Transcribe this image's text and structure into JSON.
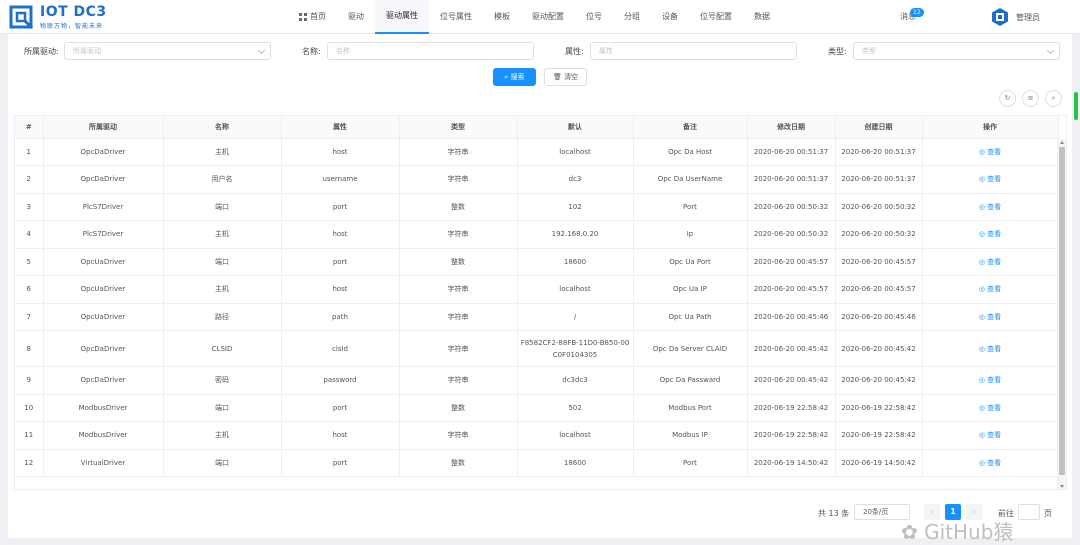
{
  "brand": {
    "title": "IOT DC3",
    "subtitle": "物联万物，智能未来",
    "accent": "#1890ff"
  },
  "nav": [
    {
      "label": "首页",
      "icon": "grid-icon"
    },
    {
      "label": "驱动"
    },
    {
      "label": "驱动属性",
      "active": true
    },
    {
      "label": "位号属性"
    },
    {
      "label": "模板"
    },
    {
      "label": "驱动配置"
    },
    {
      "label": "位号"
    },
    {
      "label": "分组"
    },
    {
      "label": "设备"
    },
    {
      "label": "位号配置"
    },
    {
      "label": "数据"
    }
  ],
  "header": {
    "messages_label": "消息",
    "messages_count": "12",
    "user_label": "管理员"
  },
  "filters": {
    "driver_label": "所属驱动:",
    "driver_placeholder": "所属驱动",
    "name_label": "名称:",
    "name_placeholder": "名称",
    "attr_label": "属性:",
    "attr_placeholder": "属性",
    "type_label": "类型:",
    "type_placeholder": "类型",
    "search_label": "搜索",
    "clear_label": "清空"
  },
  "table": {
    "columns": [
      "#",
      "所属驱动",
      "名称",
      "属性",
      "类型",
      "默认",
      "备注",
      "修改日期",
      "创建日期",
      "操作"
    ],
    "rows": [
      [
        "1",
        "OpcDaDriver",
        "主机",
        "host",
        "字符串",
        "localhost",
        "Opc Da Host",
        "2020-06-20 00:51:37",
        "2020-06-20 00:51:37",
        "查看"
      ],
      [
        "2",
        "OpcDaDriver",
        "用户名",
        "username",
        "字符串",
        "dc3",
        "Opc Da UserName",
        "2020-06-20 00:51:37",
        "2020-06-20 00:51:37",
        "查看"
      ],
      [
        "3",
        "PlcS7Driver",
        "端口",
        "port",
        "整数",
        "102",
        "Port",
        "2020-06-20 00:50:32",
        "2020-06-20 00:50:32",
        "查看"
      ],
      [
        "4",
        "PlcS7Driver",
        "主机",
        "host",
        "字符串",
        "192.168.0.20",
        "Ip",
        "2020-06-20 00:50:32",
        "2020-06-20 00:50:32",
        "查看"
      ],
      [
        "5",
        "OpcUaDriver",
        "端口",
        "port",
        "整数",
        "18600",
        "Opc Ua Port",
        "2020-06-20 00:45:57",
        "2020-06-20 00:45:57",
        "查看"
      ],
      [
        "6",
        "OpcUaDriver",
        "主机",
        "host",
        "字符串",
        "localhost",
        "Opc Ua IP",
        "2020-06-20 00:45:57",
        "2020-06-20 00:45:57",
        "查看"
      ],
      [
        "7",
        "OpcUaDriver",
        "路径",
        "path",
        "字符串",
        "/",
        "Opc Ua Path",
        "2020-06-20 00:45:46",
        "2020-06-20 00:45:46",
        "查看"
      ],
      [
        "8",
        "OpcDaDriver",
        "CLSID",
        "clsId",
        "字符串",
        "F8582CF2-88FB-11D0-B850-00C0F0104305",
        "Opc Da Server CLAID",
        "2020-06-20 00:45:42",
        "2020-06-20 00:45:42",
        "查看"
      ],
      [
        "9",
        "OpcDaDriver",
        "密码",
        "password",
        "字符串",
        "dc3dc3",
        "Opc Da Passward",
        "2020-06-20 00:45:42",
        "2020-06-20 00:45:42",
        "查看"
      ],
      [
        "10",
        "ModbusDriver",
        "端口",
        "port",
        "整数",
        "502",
        "Modbus Port",
        "2020-06-19 22:58:42",
        "2020-06-19 22:58:42",
        "查看"
      ],
      [
        "11",
        "ModbusDriver",
        "主机",
        "host",
        "字符串",
        "localhost",
        "Modbus IP",
        "2020-06-19 22:58:42",
        "2020-06-19 22:58:42",
        "查看"
      ],
      [
        "12",
        "VirtualDriver",
        "端口",
        "port",
        "整数",
        "18600",
        "Port",
        "2020-06-19 14:50:42",
        "2020-06-19 14:50:42",
        "查看"
      ]
    ]
  },
  "pagination": {
    "total": "共 13 条",
    "page_size": "20条/页",
    "current": "1",
    "goto": "前往",
    "page_suffix": "页"
  },
  "watermark": "GitHub猿"
}
